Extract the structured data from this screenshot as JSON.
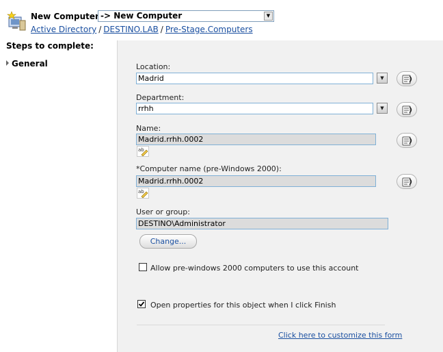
{
  "header": {
    "title": "New Computer",
    "template_select_value": "-> New Computer",
    "breadcrumb": [
      "Active Directory",
      "DESTINO.LAB",
      "Pre-Stage.Computers"
    ],
    "breadcrumb_separator": "/"
  },
  "sidebar": {
    "title": "Steps to complete:",
    "steps": [
      {
        "label": "General",
        "icon": "chevron-right-icon"
      }
    ]
  },
  "form": {
    "location_label": "Location:",
    "location_value": "Madrid",
    "department_label": "Department:",
    "department_value": "rrhh",
    "name_label": "Name:",
    "name_value": "Madrid.rrhh.0002",
    "pre2000_label": "*Computer name (pre-Windows 2000):",
    "pre2000_value": "Madrid.rrhh.0002",
    "user_group_label": "User or group:",
    "user_group_value": "DESTINO\\Administrator",
    "change_button": "Change...",
    "allow_pre2000_label": "Allow pre-windows 2000 computers to use this account",
    "allow_pre2000_checked": false,
    "open_props_label": "Open properties for this object when I click Finish",
    "open_props_checked": true,
    "customize_link": "Click here to customize this form"
  },
  "colors": {
    "link": "#1a4fa0",
    "panel_bg": "#f1f1f1",
    "field_border": "#7fb0d6",
    "readonly_bg": "#dcdcdc"
  },
  "icons": [
    "computer-wizard-icon",
    "dropdown-arrow-icon",
    "refresh-rules-icon",
    "ab-edit-icon",
    "checkmark-icon"
  ]
}
